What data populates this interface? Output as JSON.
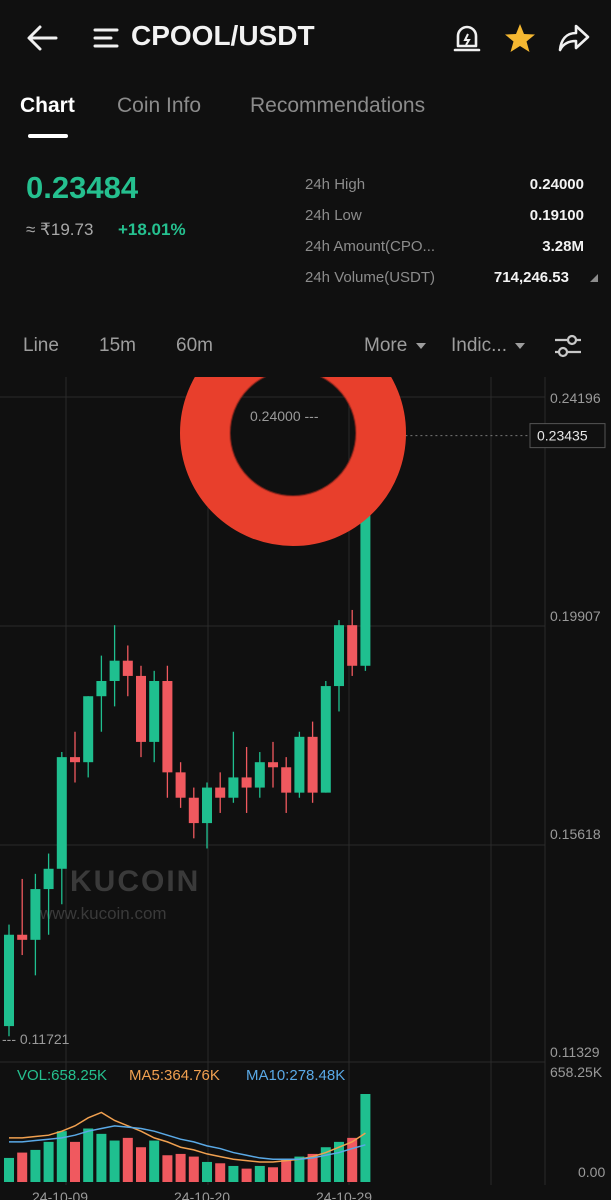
{
  "header": {
    "pair": "CPOOL/USDT",
    "icons": [
      "back-arrow-icon",
      "menu-icon",
      "price-alert-icon",
      "star-icon",
      "share-icon"
    ]
  },
  "tabs": [
    {
      "label": "Chart",
      "active": true
    },
    {
      "label": "Coin Info",
      "active": false
    },
    {
      "label": "Recommendations",
      "active": false
    }
  ],
  "ticker": {
    "last_price": "0.23484",
    "fiat_price": "≈ ₹19.73",
    "change": "+18.01%",
    "stats": [
      {
        "label": "24h High",
        "value": "0.24000"
      },
      {
        "label": "24h Low",
        "value": "0.19100"
      },
      {
        "label": "24h Amount(CPO...",
        "value": "3.28M"
      },
      {
        "label": "24h Volume(USDT)",
        "value": "714,246.53"
      }
    ]
  },
  "timeframes": {
    "line": "Line",
    "m15": "15m",
    "m60": "60m",
    "more": "More",
    "indicators": "Indic..."
  },
  "chart": {
    "y_ticks": [
      "0.24196",
      "0.19907",
      "0.15618",
      "0.11329"
    ],
    "current_price": "0.23435",
    "high_marker": "0.24000",
    "low_marker": "0.11721",
    "watermark_name": "KUCOIN",
    "watermark_url": "www.kucoin.com",
    "vol_label": "VOL:658.25K",
    "ma5_label": "MA5:364.76K",
    "ma10_label": "MA10:278.48K",
    "vol_max": "658.25K",
    "vol_min": "0.00",
    "x_ticks": [
      "24-10-09",
      "24-10-20",
      "24-10-29"
    ]
  },
  "colors": {
    "up": "#1fbf8f",
    "down": "#f0595f",
    "accent": "#25c08f",
    "star": "#f4b731",
    "ring": "#e83f2c"
  },
  "chart_data": {
    "type": "candlestick",
    "ylim": [
      0.11329,
      0.24196
    ],
    "candles": [
      {
        "o": 0.118,
        "h": 0.138,
        "l": 0.116,
        "c": 0.136
      },
      {
        "o": 0.136,
        "h": 0.147,
        "l": 0.132,
        "c": 0.135
      },
      {
        "o": 0.135,
        "h": 0.148,
        "l": 0.128,
        "c": 0.145
      },
      {
        "o": 0.145,
        "h": 0.152,
        "l": 0.136,
        "c": 0.149
      },
      {
        "o": 0.149,
        "h": 0.172,
        "l": 0.142,
        "c": 0.171
      },
      {
        "o": 0.171,
        "h": 0.176,
        "l": 0.166,
        "c": 0.17
      },
      {
        "o": 0.17,
        "h": 0.183,
        "l": 0.167,
        "c": 0.183
      },
      {
        "o": 0.183,
        "h": 0.191,
        "l": 0.176,
        "c": 0.186
      },
      {
        "o": 0.186,
        "h": 0.197,
        "l": 0.181,
        "c": 0.19
      },
      {
        "o": 0.19,
        "h": 0.193,
        "l": 0.183,
        "c": 0.187
      },
      {
        "o": 0.187,
        "h": 0.189,
        "l": 0.171,
        "c": 0.174
      },
      {
        "o": 0.174,
        "h": 0.188,
        "l": 0.17,
        "c": 0.186
      },
      {
        "o": 0.186,
        "h": 0.189,
        "l": 0.163,
        "c": 0.168
      },
      {
        "o": 0.168,
        "h": 0.17,
        "l": 0.161,
        "c": 0.163
      },
      {
        "o": 0.163,
        "h": 0.165,
        "l": 0.155,
        "c": 0.158
      },
      {
        "o": 0.158,
        "h": 0.166,
        "l": 0.153,
        "c": 0.165
      },
      {
        "o": 0.165,
        "h": 0.168,
        "l": 0.16,
        "c": 0.163
      },
      {
        "o": 0.163,
        "h": 0.176,
        "l": 0.162,
        "c": 0.167
      },
      {
        "o": 0.167,
        "h": 0.173,
        "l": 0.16,
        "c": 0.165
      },
      {
        "o": 0.165,
        "h": 0.172,
        "l": 0.163,
        "c": 0.17
      },
      {
        "o": 0.17,
        "h": 0.174,
        "l": 0.165,
        "c": 0.169
      },
      {
        "o": 0.169,
        "h": 0.171,
        "l": 0.16,
        "c": 0.164
      },
      {
        "o": 0.164,
        "h": 0.176,
        "l": 0.163,
        "c": 0.175
      },
      {
        "o": 0.175,
        "h": 0.178,
        "l": 0.162,
        "c": 0.164
      },
      {
        "o": 0.164,
        "h": 0.186,
        "l": 0.164,
        "c": 0.185
      },
      {
        "o": 0.185,
        "h": 0.198,
        "l": 0.18,
        "c": 0.197
      },
      {
        "o": 0.197,
        "h": 0.2,
        "l": 0.187,
        "c": 0.189
      },
      {
        "o": 0.189,
        "h": 0.236,
        "l": 0.188,
        "c": 0.234
      }
    ],
    "volumes": [
      180,
      220,
      240,
      300,
      380,
      300,
      400,
      360,
      310,
      330,
      260,
      310,
      200,
      210,
      190,
      150,
      140,
      120,
      100,
      120,
      110,
      170,
      190,
      210,
      260,
      300,
      330,
      658
    ],
    "ma5": [
      330,
      330,
      340,
      350,
      380,
      420,
      480,
      520,
      460,
      420,
      380,
      330,
      300,
      260,
      240,
      210,
      190,
      170,
      160,
      150,
      150,
      160,
      170,
      190,
      220,
      260,
      300,
      365
    ],
    "ma10": [
      300,
      300,
      310,
      320,
      330,
      350,
      380,
      400,
      420,
      410,
      400,
      380,
      350,
      320,
      300,
      270,
      250,
      220,
      200,
      180,
      170,
      170,
      170,
      180,
      200,
      220,
      250,
      278
    ]
  }
}
